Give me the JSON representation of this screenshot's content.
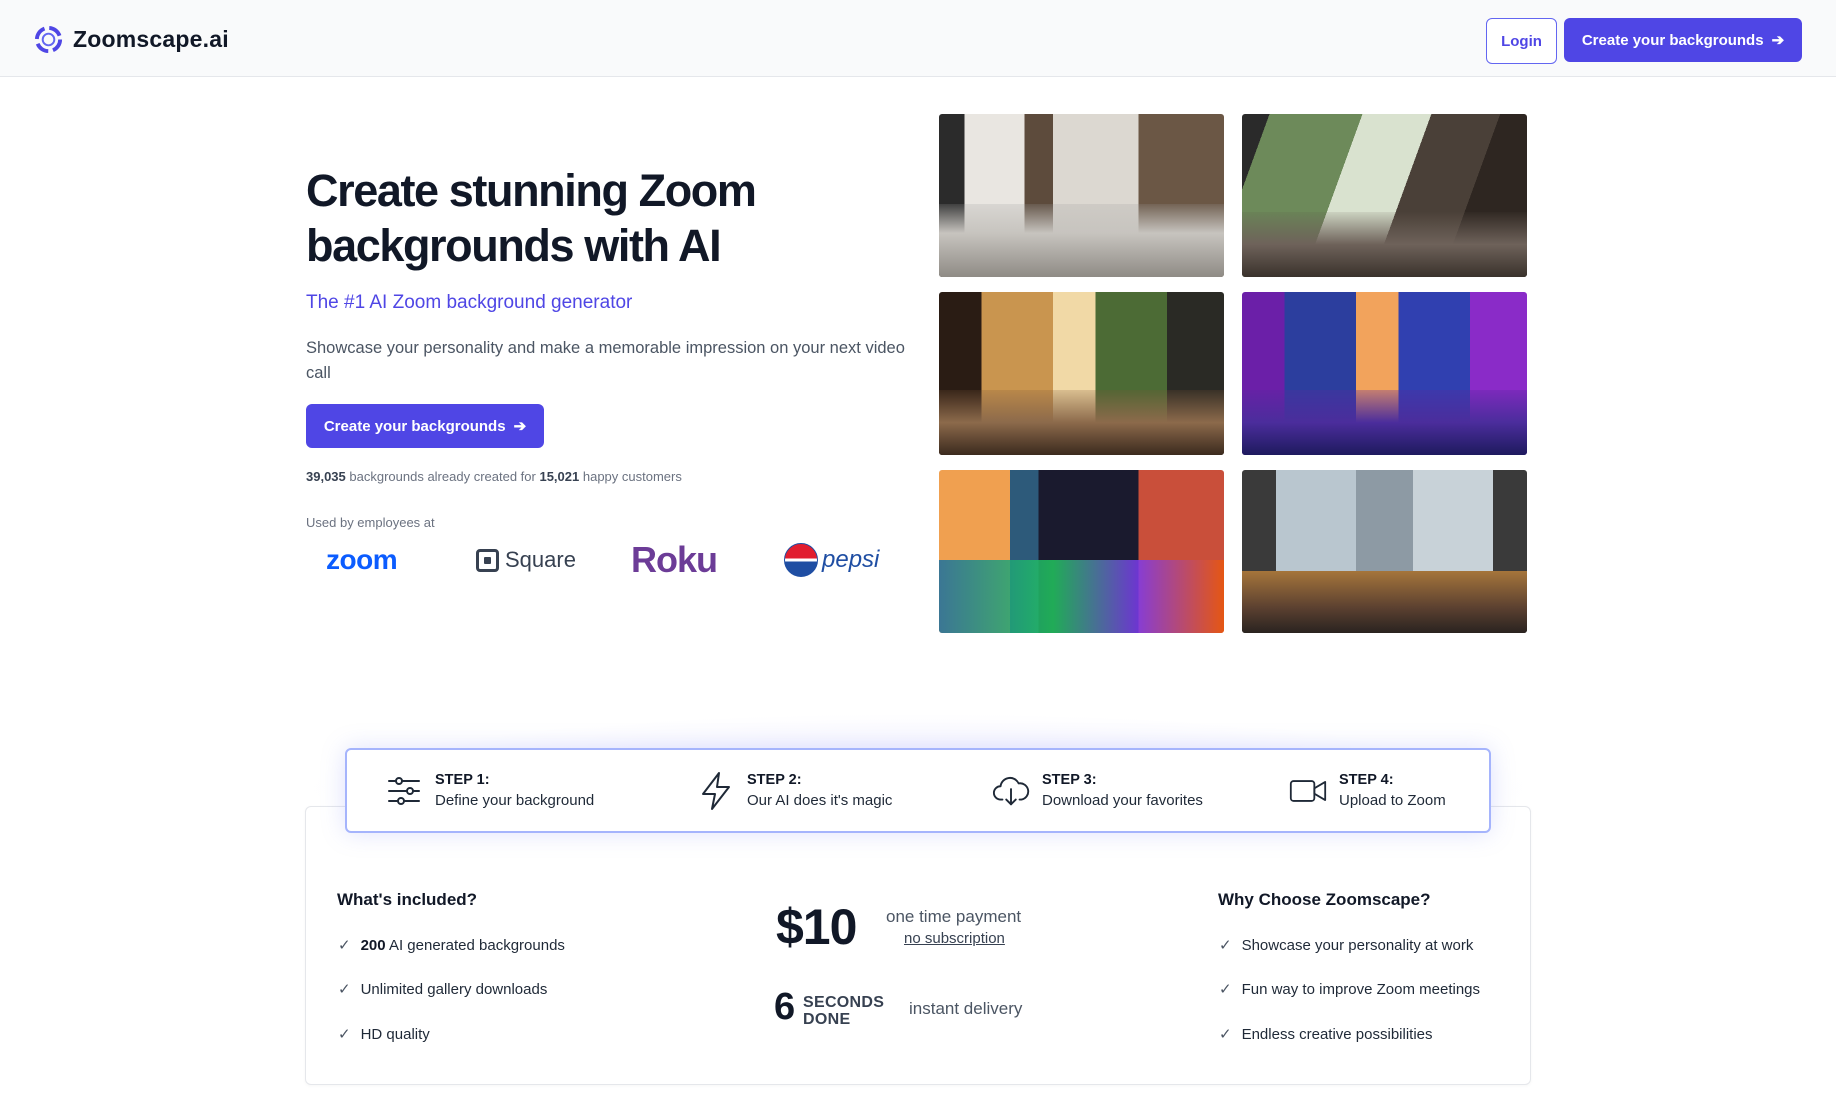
{
  "header": {
    "brand": "Zoomscape.ai",
    "login_label": "Login",
    "cta_label": "Create your backgrounds",
    "cta_icon": "arrow-right-icon",
    "brand_color": "#4f46e5"
  },
  "hero": {
    "title": "Create stunning Zoom backgrounds with AI",
    "subtitle": "The #1 AI Zoom background generator",
    "description": "Showcase your personality and make a memorable impression on your next video call",
    "cta_label": "Create your backgrounds",
    "stats": {
      "backgrounds_count": "39,035",
      "backgrounds_text": "backgrounds already created for",
      "customers_count": "15,021",
      "customers_text": "happy customers"
    },
    "used_by_label": "Used by employees at",
    "logos": [
      "zoom",
      "Square",
      "Roku",
      "pepsi"
    ]
  },
  "gallery": {
    "images": [
      "modern-living-room-image",
      "forest-view-loft-image",
      "tropical-lounge-image",
      "neon-city-bedroom-image",
      "neon-sunset-bedroom-image",
      "mountain-view-living-room-image"
    ]
  },
  "steps": [
    {
      "number": "STEP 1:",
      "description": "Define your background",
      "icon": "sliders-icon"
    },
    {
      "number": "STEP 2:",
      "description": "Our AI does it's magic",
      "icon": "lightning-icon"
    },
    {
      "number": "STEP 3:",
      "description": "Download your favorites",
      "icon": "cloud-download-icon"
    },
    {
      "number": "STEP 4:",
      "description": "Upload to Zoom",
      "icon": "video-camera-icon"
    }
  ],
  "pricing": {
    "included_title": "What's included?",
    "included": [
      {
        "bold": "200",
        "text": "AI generated backgrounds"
      },
      {
        "bold": "",
        "text": "Unlimited gallery downloads"
      },
      {
        "bold": "",
        "text": "HD quality"
      }
    ],
    "price": "$10",
    "price_label": "one time payment",
    "no_subscription": "no subscription",
    "delivery_number": "6",
    "delivery_unit_line1": "SECONDS",
    "delivery_unit_line2": "DONE",
    "delivery_label": "instant delivery",
    "why_title": "Why Choose Zoomscape?",
    "why": [
      "Showcase your personality at work",
      "Fun way to improve Zoom meetings",
      "Endless creative possibilities"
    ]
  }
}
